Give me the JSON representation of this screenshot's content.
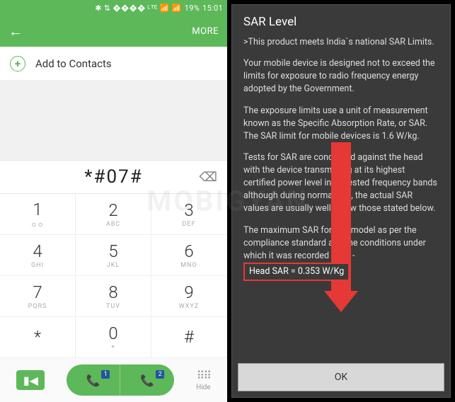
{
  "status": {
    "icons": "✱ ⇅ ���� ᴸᵀᴱ 📶 📶",
    "battery": "19%",
    "time": "15:01"
  },
  "appbar": {
    "more": "MORE"
  },
  "addContacts": "Add to Contacts",
  "dialed": "*#07#",
  "keys": [
    {
      "d": "1",
      "s": "ㅇㅇ"
    },
    {
      "d": "2",
      "s": "ABC"
    },
    {
      "d": "3",
      "s": "DEF"
    },
    {
      "d": "4",
      "s": "GHI"
    },
    {
      "d": "5",
      "s": "JKL"
    },
    {
      "d": "6",
      "s": "MNO"
    },
    {
      "d": "7",
      "s": "PQRS"
    },
    {
      "d": "8",
      "s": "TUV"
    },
    {
      "d": "9",
      "s": "WXYZ"
    },
    {
      "d": "*",
      "s": ""
    },
    {
      "d": "0",
      "s": "+"
    },
    {
      "d": "#",
      "s": ""
    }
  ],
  "hide": "Hide",
  "sim": {
    "a": "1",
    "b": "2"
  },
  "dialog": {
    "title": "SAR Level",
    "p1": ">This product meets India`s national SAR Limits.",
    "p2": "Your mobile device is designed not to exceed the limits for exposure to radio frequency energy adopted by the Government.",
    "p3": "The exposure limits use a unit of measurement known as the Specific Absorption Rate, or SAR.",
    "p3b": "The SAR limit for mobile devices is 1.6 W/kg.",
    "p4": "Tests for SAR are conducted against the head with the device transmitting at its highest certified power level in all tested frequency bands although during normal use, the actual SAR values are usually well below those stated below.",
    "p5a": "The maximum SAR for this model as per the compliance standard and the conditions under which it was recorded were -",
    "highlight": "Head SAR = 0.353 W/Kg",
    "ok": "OK"
  },
  "watermark": "MOBIGYAN"
}
